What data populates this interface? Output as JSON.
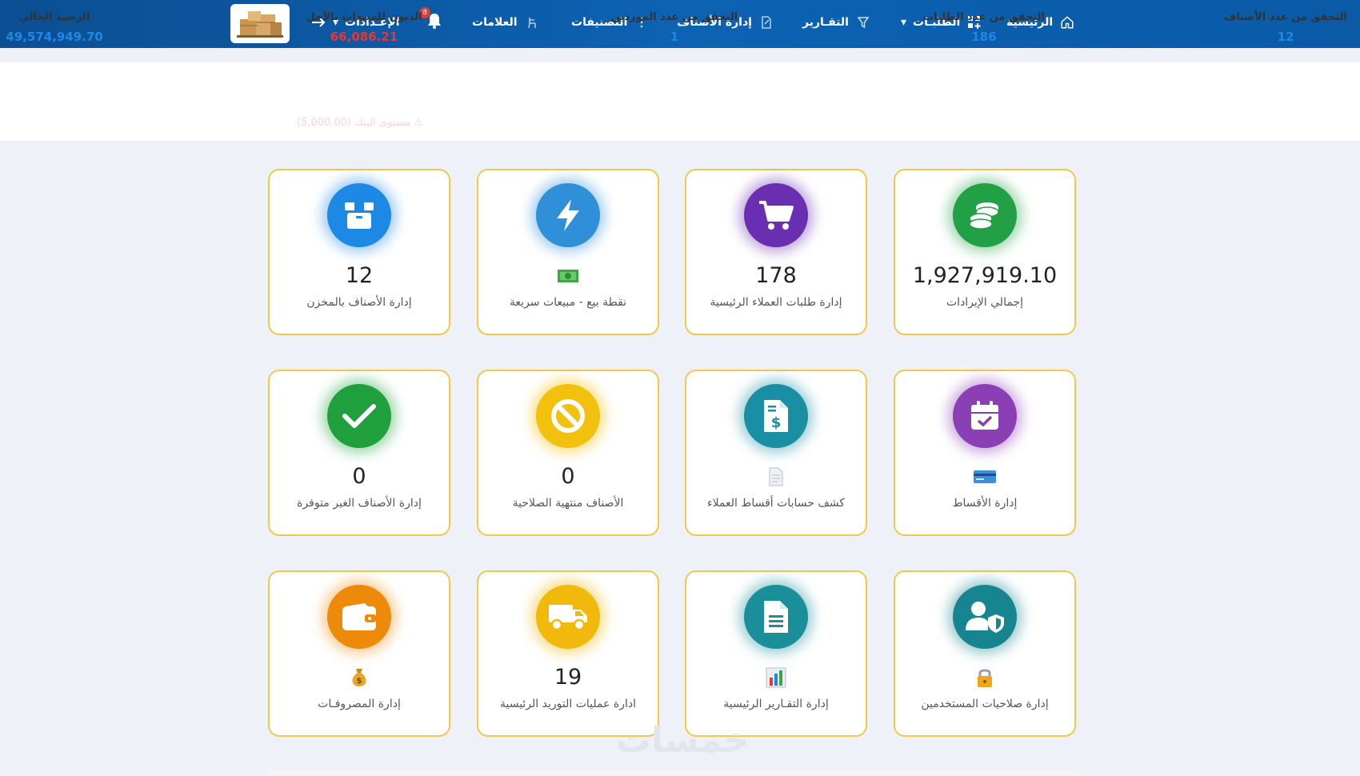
{
  "nav": {
    "home": "الرئيسية",
    "orders": "الطلبـات",
    "reports": "التقـارير",
    "items": "إدارة الأصناف",
    "categories": "التصنيفات",
    "brands": "العلامات",
    "settings": "الإعـدادات",
    "bell_badge": "8",
    "orders_icon": "grid-icon",
    "reports_icon": "filter-icon",
    "items_icon": "document-edit-icon",
    "categories_icon": "kebab-icon",
    "brands_icon": "chair-icon"
  },
  "stats": [
    {
      "label": "التحقق من عدد الأصناف",
      "value": "12",
      "color": "#1e88e5"
    },
    {
      "label": "التحقق من عدد الطلبات",
      "value": "186",
      "color": "#1e88e5"
    },
    {
      "label": "التحقق من عدد الموردين",
      "value": "1",
      "color": "#1e88e5"
    },
    {
      "label": "الديون للمبيعات بالآجل",
      "value": "66,086.21",
      "color": "#e53935"
    },
    {
      "label": "الرصيد الحالي",
      "value": "49,574,949.70",
      "color": "#1e88e5"
    }
  ],
  "faint_text": "⚠ مستوى البنك (5,000.00)",
  "cards": [
    {
      "title": "إجمالي الإيرادات",
      "value": "1,927,919.10",
      "icon": "coins-icon",
      "color": "#22a046"
    },
    {
      "title": "إدارة طلبات العملاء الرئيسية",
      "value": "178",
      "icon": "cart-icon",
      "color": "#6a2fb0"
    },
    {
      "title": "نقطة بيع - مبيعات سريعة",
      "value": "",
      "icon": "bolt-icon",
      "mini_icon": "money-icon",
      "color": "#2f8fd8"
    },
    {
      "title": "إدارة الأصناف بالمخزن",
      "value": "12",
      "icon": "box-icon",
      "color": "#1e88e5"
    },
    {
      "title": "إدارة الأقساط",
      "value": "",
      "icon": "calendar-check-icon",
      "mini_icon": "credit-card-icon",
      "color": "#8b3fb4"
    },
    {
      "title": "كشف حسابات أقساط العملاء",
      "value": "",
      "icon": "invoice-dollar-icon",
      "mini_icon": "page-icon",
      "color": "#1a8fa4"
    },
    {
      "title": "الأصناف منتهية الصلاحية",
      "value": "0",
      "icon": "ban-icon",
      "color": "#f2c10e"
    },
    {
      "title": "إدارة الأصناف الغير متوفرة",
      "value": "0",
      "icon": "check-icon",
      "color": "#20a03c"
    },
    {
      "title": "إدارة صلاحيات المستخدمين",
      "value": "",
      "icon": "user-shield-icon",
      "mini_icon": "lock-icon",
      "color": "#17858f"
    },
    {
      "title": "إدارة التقـارير الرئيسية",
      "value": "",
      "icon": "file-icon",
      "mini_icon": "bar-chart-icon",
      "color": "#1a8f99"
    },
    {
      "title": "ادارة عمليات التوريد الرئيسية",
      "value": "19",
      "icon": "truck-icon",
      "color": "#f0b90c"
    },
    {
      "title": "إدارة المصروفـات",
      "value": "",
      "icon": "wallet-icon",
      "mini_icon": "money-bag-icon",
      "color": "#ee8a0a"
    }
  ],
  "watermark": "خمسات"
}
